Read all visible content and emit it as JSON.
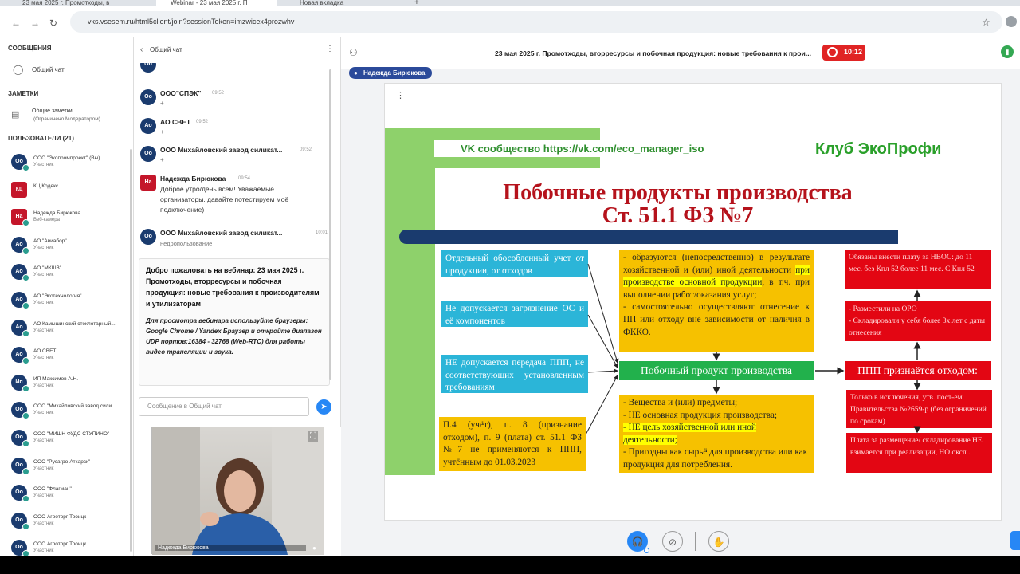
{
  "browser": {
    "tabs": [
      {
        "label": "23 мая 2025 г. Промотходы, в"
      },
      {
        "label": "Webinar - 23 мая 2025 г. П"
      },
      {
        "label": "Новая вкладка"
      }
    ],
    "new_tab": "+",
    "url": "vks.vsesem.ru/html5client/join?sessionToken=imzwicex4prozwhv"
  },
  "sidebar": {
    "messages_header": "СООБЩЕНИЯ",
    "general_chat": "Общий чат",
    "notes_header": "ЗАМЕТКИ",
    "shared_notes": "Общие заметки",
    "shared_notes_sub": "(Ограничено Модератором)",
    "users_header": "ПОЛЬЗОВАТЕЛИ (21)",
    "users": [
      {
        "initials": "Оо",
        "name": "ООО \"Экопромпроект\" (Вы)",
        "role": "Участник"
      },
      {
        "initials": "Кц",
        "name": "КЦ Кодекс",
        "role": ""
      },
      {
        "initials": "На",
        "name": "Надежда Бирюкова",
        "role": "Веб-камера"
      },
      {
        "initials": "Ао",
        "name": "АО \"Авиабор\"",
        "role": "Участник"
      },
      {
        "initials": "Ао",
        "name": "АО \"МКШВ\"",
        "role": "Участник"
      },
      {
        "initials": "Ао",
        "name": "АО \"Экотехнология\"",
        "role": "Участник"
      },
      {
        "initials": "Ао",
        "name": "АО Камышинский стеклотарный...",
        "role": "Участник"
      },
      {
        "initials": "Ао",
        "name": "АО СВЕТ",
        "role": "Участник"
      },
      {
        "initials": "Ип",
        "name": "ИП Максимов А.Н.",
        "role": "Участник"
      },
      {
        "initials": "Оо",
        "name": "ООО \"Михайловский завод сили...",
        "role": "Участник"
      },
      {
        "initials": "Оо",
        "name": "ООО \"МИШН ФУДС СТУПИНО\"",
        "role": "Участник"
      },
      {
        "initials": "Оо",
        "name": "ООО \"Русагро-Аткарск\"",
        "role": "Участник"
      },
      {
        "initials": "Оо",
        "name": "ООО \"Флагман\"",
        "role": "Участник"
      },
      {
        "initials": "Оо",
        "name": "ООО Агроторг Троицк",
        "role": "Участник"
      },
      {
        "initials": "Оо",
        "name": "ООО Агроторг Троицк",
        "role": "Участник"
      }
    ]
  },
  "chat": {
    "title": "Общий чат",
    "messages": [
      {
        "initials": "Оо",
        "name": "ООО\"СПЭК\"",
        "time": "09:52",
        "text": "+"
      },
      {
        "initials": "Ао",
        "name": "АО СВЕТ",
        "time": "09:52",
        "text": "+"
      },
      {
        "initials": "Оо",
        "name": "ООО Михайловский завод силикат...",
        "time": "09:52",
        "text": "+"
      },
      {
        "initials": "На",
        "name": "Надежда Бирюкова",
        "time": "09:54",
        "text": "Доброе утро/день всем! Уважаемые организаторы, давайте потестируем моё подключение)"
      },
      {
        "initials": "Оо",
        "name": "ООО Михайловский завод силикат...",
        "time": "10:01",
        "text": "недропользование"
      }
    ],
    "welcome_title": "Добро пожаловать на вебинар: 23 мая 2025 г. Промотходы, вторресурсы и побочная продукция: новые требования к производителям и утилизаторам",
    "welcome_note": "Для просмотра вебинара используйте браузеры: Google Chrome / Yandex Браузер и откройте диапазон UDP портов:16384 - 32768 (Web-RTC) для работы видео трансляции и звука.",
    "input_placeholder": "Сообщение в Общий чат",
    "send_icon": "➤"
  },
  "video": {
    "presenter": "Надежда Бирюкова"
  },
  "conference": {
    "title": "23 мая 2025 г. Промотходы, вторресурсы и побочная продукция: новые требования к прои...",
    "timer": "10:12",
    "presenter": "Надежда Бирюкова"
  },
  "slide": {
    "vk_text": "VK сообщество https://vk.com/eco_manager_iso",
    "club": "Клуб ЭкоПрофи",
    "title1": "Побочные продукты производства",
    "title2": "Ст. 51.1 ФЗ №7",
    "left_boxes": [
      "Отдельный обособленный учет от продукции, от отходов",
      "Не допускается загрязнение ОС и её компонентов",
      "НЕ допускается передача ППП, не соответствующих установленным требованиям",
      "П.4 (учёт), п. 8 (признание отходом), п. 9 (плата) ст. 51.1 ФЗ №7 не применяются к ППП, учтённым до 01.03.2023"
    ],
    "center_top_a": "- образуются (непосредственно) в результате хозяйственной и (или) иной деятельности ",
    "center_top_hl": "при производстве основной продукции",
    "center_top_b": ", в т.ч. при выполнении работ/оказания услуг;",
    "center_top_c": "- самостоятельно осуществляют отнесение к ПП или отходу вне зависимости от наличия в ФККО.",
    "center_green": "Побочный продукт производства",
    "center_bottom_1": "- Вещества и (или) предметы;",
    "center_bottom_2": "- НЕ основная продукция производства;",
    "center_bottom_3": "- НЕ цель хозяйственной или иной деятельности;",
    "center_bottom_4": "- Пригодны как сырьё для производства или как продукция для потребления.",
    "right_boxes": [
      "Обязаны внести плату за НВОС: до 11 мес. без Кпл 52 более 11 мес. С Кпл 52",
      "- Разместили на ОРО\n- Складировали у себя более 3х лет с даты отнесения",
      "ППП признаётся отходом:",
      "Только в исключения, утв. пост-ем Правительства №2659-р (без ограничений по срокам)",
      "Плата за размещение/ складирование НЕ взимается при реализации, НО оксл..."
    ]
  }
}
